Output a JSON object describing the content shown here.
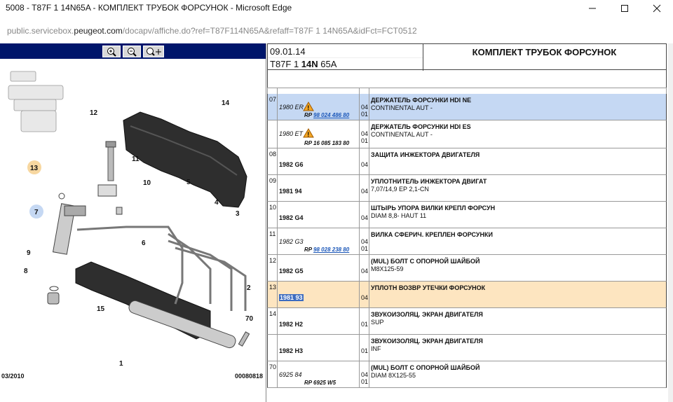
{
  "window": {
    "title": "5008 - T87F 1 14N65A - КОМПЛЕКТ ТРУБОК ФОРСУНОК - Microsoft Edge"
  },
  "address": {
    "host_prefix": "public.servicebox.",
    "host_domain": "peugeot.com",
    "path": "/docapv/affiche.do?ref=T87F114N65A&refaff=T87F 1 14N65A&idFct=FCT0512"
  },
  "toolbar": {
    "zoom_in_icon": "zoom-in-icon",
    "zoom_out_icon": "zoom-out-icon",
    "pan_icon": "pan-icon"
  },
  "diagram": {
    "labels": [
      "14",
      "12",
      "11",
      "10",
      "13",
      "5",
      "7",
      "4",
      "3",
      "6",
      "9",
      "8",
      "2",
      "15",
      "70",
      "1"
    ],
    "footer_left": "03/2010",
    "footer_right": "00080818"
  },
  "header": {
    "date": "09.01.14",
    "ref_prefix": "T87F 1 ",
    "ref_bold": "14N",
    "ref_suffix": " 65A",
    "title": "КОМПЛЕКТ ТРУБОК ФОРСУНОК"
  },
  "rows": [
    {
      "no": "07",
      "ref": "1980 ER",
      "ref_italic": true,
      "warn": true,
      "rp_prefix": "RP ",
      "rp_link": "98 024 486 80",
      "qty1": "04",
      "qty2": "01",
      "title": "ДЕРЖАТЕЛЬ ФОРСУНКИ HDI NE",
      "sub": "CONTINENTAL AUT -",
      "highlight": "blue"
    },
    {
      "no": "",
      "ref": "1980 ET",
      "ref_italic": true,
      "warn": true,
      "rp_prefix": "RP 16 085 183 80",
      "rp_link": "",
      "qty1": "04",
      "qty2": "01",
      "title": "ДЕРЖАТЕЛЬ ФОРСУНКИ HDI ES",
      "sub": "CONTINENTAL AUT -",
      "highlight": ""
    },
    {
      "no": "08",
      "ref": "1982 G6",
      "ref_italic": false,
      "warn": false,
      "rp_prefix": "",
      "rp_link": "",
      "qty1": "04",
      "qty2": "",
      "title": "ЗАЩИТА ИНЖЕКТОРА ДВИГАТЕЛЯ",
      "sub": "",
      "highlight": ""
    },
    {
      "no": "09",
      "ref": "1981 94",
      "ref_italic": false,
      "warn": false,
      "rp_prefix": "",
      "rp_link": "",
      "qty1": "04",
      "qty2": "",
      "title": "УПЛОТНИТЕЛЬ ИНЖЕКТОРА ДВИГАТ",
      "sub": "7,07/14,9 EP 2,1-CN",
      "highlight": ""
    },
    {
      "no": "10",
      "ref": "1982 G4",
      "ref_italic": false,
      "warn": false,
      "rp_prefix": "",
      "rp_link": "",
      "qty1": "04",
      "qty2": "",
      "title": "ШТЫРЬ УПОРА ВИЛКИ КРЕПЛ ФОРСУН",
      "sub": "DIAM 8,8- HAUT 11",
      "highlight": ""
    },
    {
      "no": "11",
      "ref": "1982 G3",
      "ref_italic": true,
      "warn": false,
      "rp_prefix": "RP ",
      "rp_link": "98 028 238 80",
      "qty1": "04",
      "qty2": "01",
      "title": "ВИЛКА СФЕРИЧ. КРЕПЛЕН ФОРСУНКИ",
      "sub": "",
      "highlight": ""
    },
    {
      "no": "12",
      "ref": "1982 G5",
      "ref_italic": false,
      "warn": false,
      "rp_prefix": "",
      "rp_link": "",
      "qty1": "04",
      "qty2": "",
      "title": "(MUL) БОЛТ С ОПОРНОЙ ШАЙБОЙ",
      "sub": "M8X125-59",
      "highlight": ""
    },
    {
      "no": "13",
      "ref": "1981 93",
      "ref_italic": false,
      "warn": false,
      "rp_prefix": "",
      "rp_link": "",
      "qty1": "04",
      "qty2": "",
      "title": "УПЛОТН ВОЗВР УТЕЧКИ ФОРСУНОК",
      "sub": "",
      "highlight": "orange",
      "selected": true
    },
    {
      "no": "14",
      "ref": "1982 H2",
      "ref_italic": false,
      "warn": false,
      "rp_prefix": "",
      "rp_link": "",
      "qty1": "01",
      "qty2": "",
      "title": "ЗВУКОИЗОЛЯЦ. ЭКРАН ДВИГАТЕЛЯ",
      "sub": "SUP",
      "highlight": ""
    },
    {
      "no": "",
      "ref": "1982 H3",
      "ref_italic": false,
      "warn": false,
      "rp_prefix": "",
      "rp_link": "",
      "qty1": "01",
      "qty2": "",
      "title": "ЗВУКОИЗОЛЯЦ. ЭКРАН ДВИГАТЕЛЯ",
      "sub": "INF",
      "highlight": ""
    },
    {
      "no": "70",
      "ref": "6925 84",
      "ref_italic": true,
      "warn": false,
      "rp_prefix": "RP 6925 W5",
      "rp_link": "",
      "qty1": "04",
      "qty2": "01",
      "title": "(MUL) БОЛТ С ОПОРНОЙ ШАЙБОЙ",
      "sub": "DIAM 8X125-55",
      "highlight": ""
    }
  ],
  "colors": {
    "toolbar_bg": "#00166b",
    "row_highlight_blue": "#c5d8f3",
    "row_highlight_orange": "#fde5c0",
    "link": "#1a56b8"
  }
}
